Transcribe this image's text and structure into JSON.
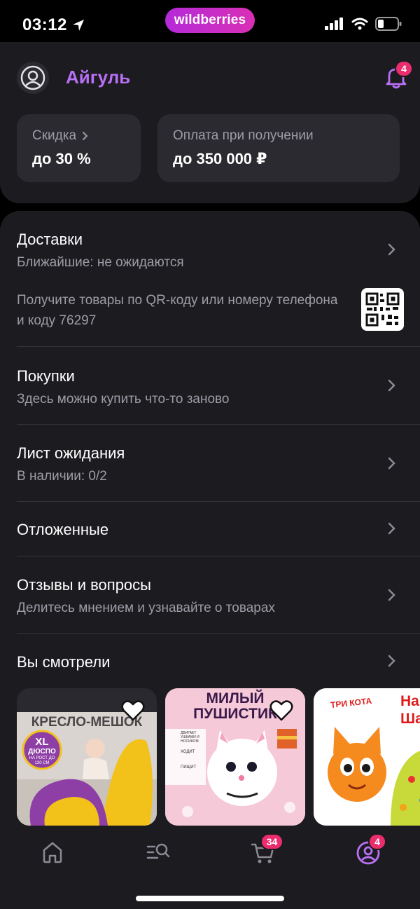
{
  "status_bar": {
    "time": "03:12",
    "brand": "wildberries"
  },
  "profile": {
    "name": "Айгуль",
    "notifications_count": "4",
    "discount": {
      "label": "Скидка",
      "value": "до 30 %"
    },
    "payment": {
      "label": "Оплата при получении",
      "value": "до 350 000 ₽"
    }
  },
  "menu": {
    "deliveries": {
      "title": "Доставки",
      "subtitle": "Ближайшие: не ожидаются"
    },
    "qr_hint": "Получите товары по QR-коду или номеру телефона и коду 76297",
    "purchases": {
      "title": "Покупки",
      "subtitle": "Здесь можно купить что-то заново"
    },
    "waitlist": {
      "title": "Лист ожидания",
      "subtitle": "В наличии: 0/2"
    },
    "saved": {
      "title": "Отложенные"
    },
    "reviews": {
      "title": "Отзывы и вопросы",
      "subtitle": "Делитесь мнением и узнавайте о товарах"
    },
    "viewed": {
      "title": "Вы смотрели"
    }
  },
  "products": [
    {
      "banner": "КРЕСЛО-МЕШОК",
      "badge_big": "XL",
      "badge_small": "ДЮСПО",
      "badge_note": "НА РОСТ ДО 130 СМ"
    },
    {
      "title_line1": "МИЛЫЙ",
      "title_line2": "ПУШИСТИК",
      "feature1": "ДВИГАЕТ УШКАМИ И НОСИКОМ",
      "feature2": "ХОДИТ",
      "feature3": "ПИЩИТ"
    },
    {
      "tag": "ТРИ КОТА",
      "title_part1": "На",
      "title_part2": "Ша"
    }
  ],
  "tab_bar": {
    "cart_count": "34",
    "profile_count": "4"
  },
  "colors": {
    "accent": "#b870f5",
    "badge": "#ec2d6d",
    "card": "#1c1b20",
    "brand_from": "#b52ad9",
    "brand_to": "#d92fb5"
  }
}
